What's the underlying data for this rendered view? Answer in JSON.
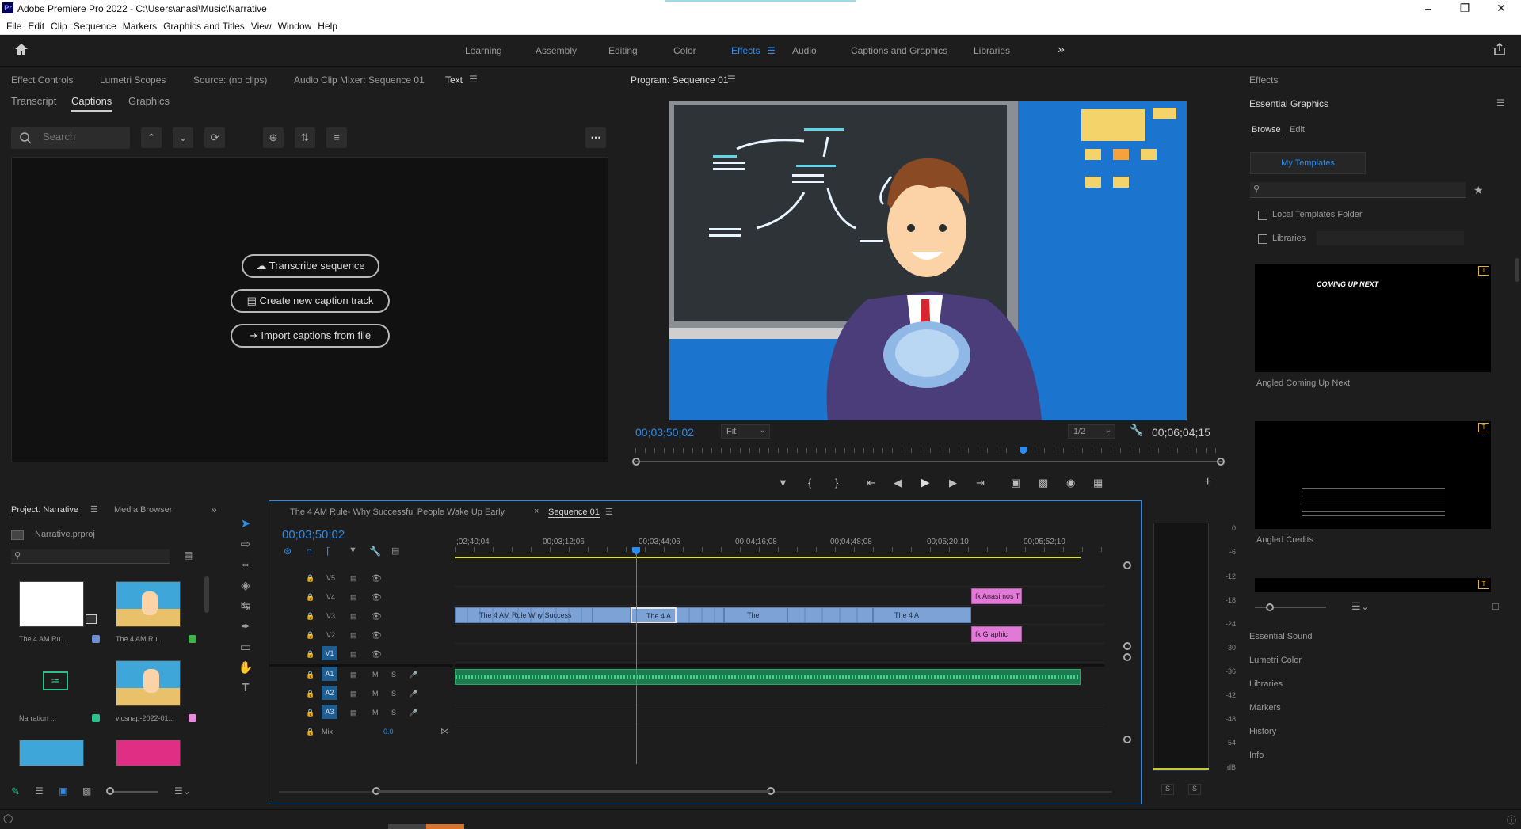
{
  "app": {
    "title": "Adobe Premiere Pro 2022 - C:\\Users\\anasi\\Music\\Narrative",
    "logo": "Pr"
  },
  "menu": [
    "File",
    "Edit",
    "Clip",
    "Sequence",
    "Markers",
    "Graphics and Titles",
    "View",
    "Window",
    "Help"
  ],
  "workspaces": [
    "Learning",
    "Assembly",
    "Editing",
    "Color",
    "Effects",
    "Audio",
    "Captions and Graphics",
    "Libraries"
  ],
  "workspace_overflow": "»",
  "left_tabs": [
    "Effect Controls",
    "Lumetri Scopes",
    "Source: (no clips)",
    "Audio Clip Mixer: Sequence 01",
    "Text"
  ],
  "text_subtabs": [
    "Transcript",
    "Captions",
    "Graphics"
  ],
  "search_placeholder": "Search",
  "captions_buttons": [
    "Transcribe sequence",
    "Create new caption track",
    "Import captions from file"
  ],
  "program": {
    "title": "Program: Sequence 01",
    "timecode": "00;03;50;02",
    "fit": "Fit",
    "resolution": "1/2",
    "duration": "00;06;04;15",
    "playhead_pct": 0.66
  },
  "effects_panel": {
    "title": "Effects",
    "eg_title": "Essential Graphics",
    "tabs": [
      "Browse",
      "Edit"
    ],
    "my_templates": "My Templates",
    "chk_local": "Local Templates Folder",
    "chk_libraries": "Libraries",
    "templates": [
      {
        "name": "Angled Coming Up Next",
        "text": "COMING UP NEXT"
      },
      {
        "name": "Angled Credits"
      }
    ],
    "sections": [
      "Essential Sound",
      "Lumetri Color",
      "Libraries",
      "Markers",
      "History",
      "Info"
    ]
  },
  "project": {
    "title": "Project: Narrative",
    "media_browser": "Media Browser",
    "file": "Narrative.prproj",
    "items": [
      {
        "label": "The 4 AM Ru...",
        "color": "#6f8fd0"
      },
      {
        "label": "The 4 AM Rul...",
        "color": "#3fb34a"
      },
      {
        "label": "Narration ...",
        "color": "#2ec08a"
      },
      {
        "label": "vlcsnap-2022-01...",
        "color": "#e88be0"
      }
    ]
  },
  "timeline": {
    "tabs": [
      "The 4 AM Rule- Why Successful People Wake Up Early",
      "Sequence 01"
    ],
    "timecode": "00;03;50;02",
    "ruler": [
      ";02;40;04",
      "00;03;12;06",
      "00;03;44;06",
      "00;04;16;08",
      "00;04;48;08",
      "00;05;20;10",
      "00;05;52;10"
    ],
    "video_tracks": [
      "V5",
      "V4",
      "V3",
      "V2",
      "V1"
    ],
    "audio_tracks": [
      "A1",
      "A2",
      "A3"
    ],
    "mix": {
      "label": "Mix",
      "value": "0.0"
    },
    "clips": {
      "v4": "Anasimos T",
      "v3": [
        "The 4 AM Rule Why Success",
        "The 4 A",
        "The",
        "The 4 A"
      ],
      "v2": "Graphic"
    }
  },
  "meter": {
    "scale": [
      "0",
      "-6",
      "-12",
      "-18",
      "-24",
      "-30",
      "-36",
      "-42",
      "-48",
      "-54",
      "dB"
    ],
    "solo": [
      "S",
      "S"
    ]
  }
}
